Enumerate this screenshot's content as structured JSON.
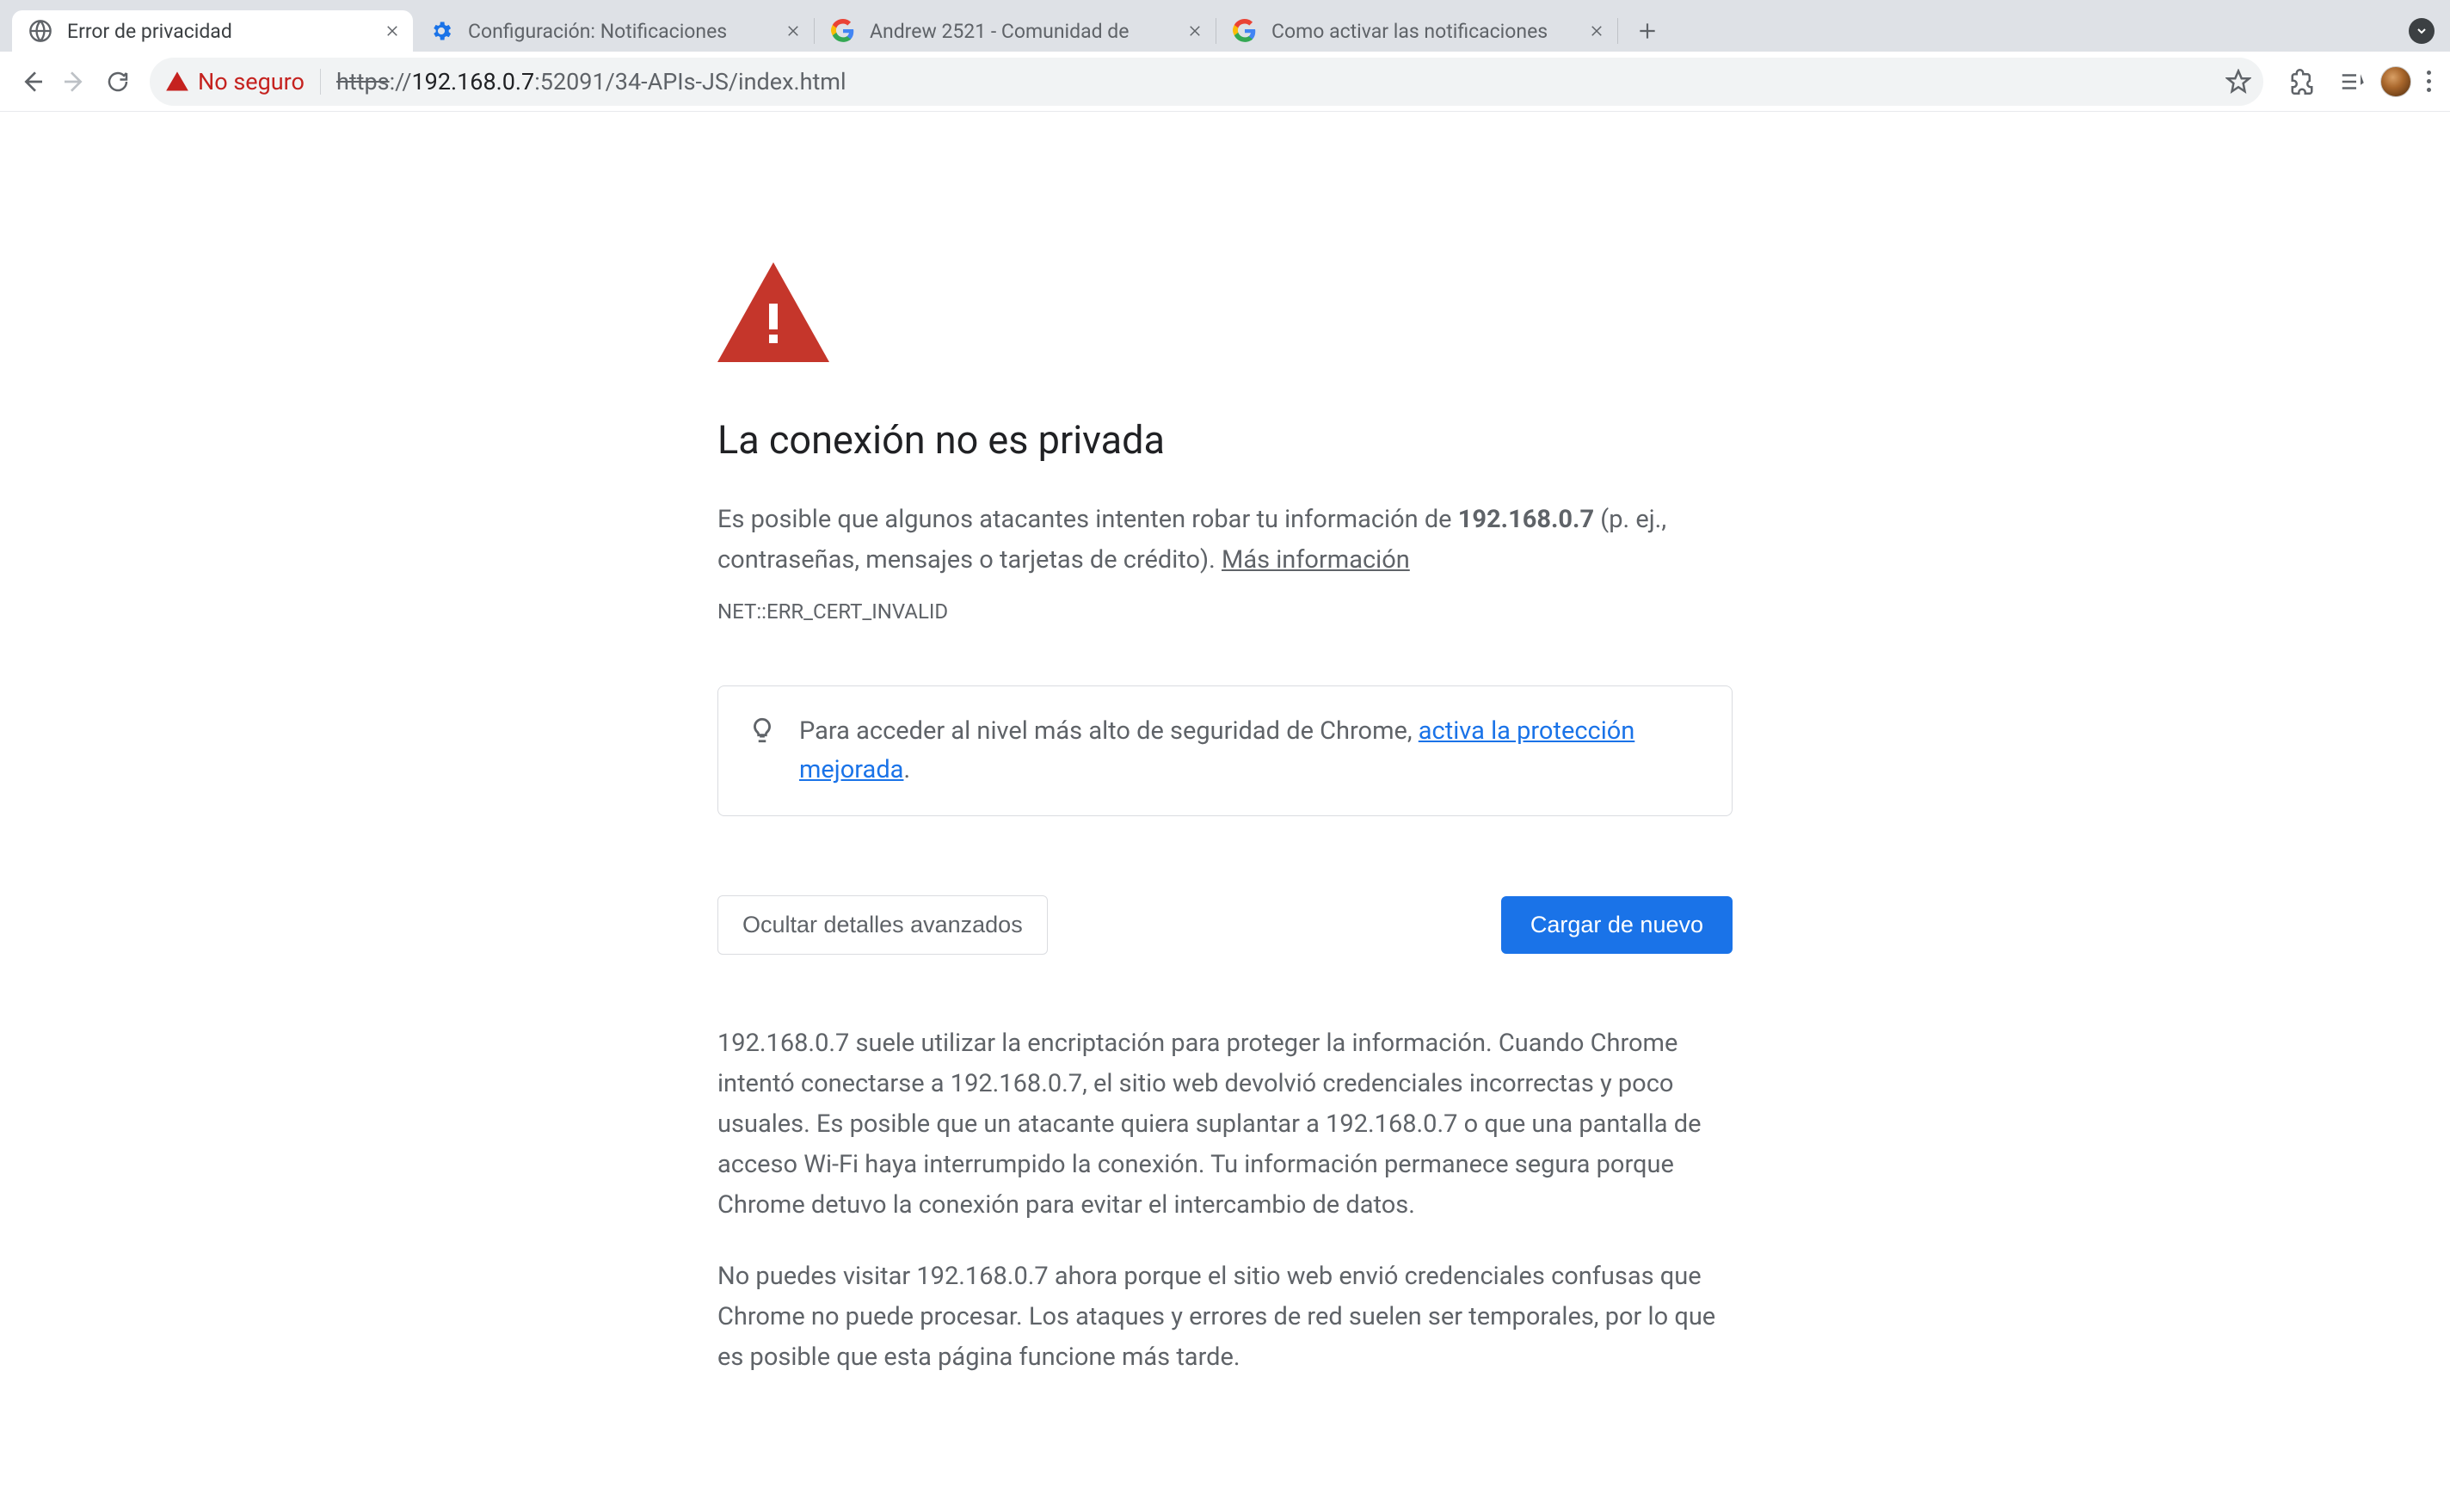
{
  "tabs": [
    {
      "title": "Error de privacidad",
      "icon": "globe"
    },
    {
      "title": "Configuración: Notificaciones",
      "icon": "gear"
    },
    {
      "title": "Andrew 2521 - Comunidad de",
      "icon": "google"
    },
    {
      "title": "Como activar las notificaciones",
      "icon": "google"
    }
  ],
  "omnibox": {
    "security_label": "No seguro",
    "url_scheme": "https",
    "url_sep": "://",
    "url_main": "192.168.0.7",
    "url_rest": ":52091/34-APIs-JS/index.html"
  },
  "page": {
    "heading": "La conexión no es privada",
    "p1a": "Es posible que algunos atacantes intenten robar tu información de ",
    "p1b_bold": "192.168.0.7",
    "p1c": " (p. ej., contraseñas, mensajes o tarjetas de crédito). ",
    "p1_link": "Más información",
    "error_code": "NET::ERR_CERT_INVALID",
    "tip_a": "Para acceder al nivel más alto de seguridad de Chrome, ",
    "tip_link": "activa la protección mejorada",
    "tip_b": ".",
    "btn_hide": "Ocultar detalles avanzados",
    "btn_reload": "Cargar de nuevo",
    "details_p1": "192.168.0.7 suele utilizar la encriptación para proteger la información. Cuando Chrome intentó conectarse a 192.168.0.7, el sitio web devolvió credenciales incorrectas y poco usuales. Es posible que un atacante quiera suplantar a 192.168.0.7 o que una pantalla de acceso Wi-Fi haya interrumpido la conexión. Tu información permanece segura porque Chrome detuvo la conexión para evitar el intercambio de datos.",
    "details_p2": "No puedes visitar 192.168.0.7 ahora porque el sitio web envió credenciales confusas que Chrome no puede procesar. Los ataques y errores de red suelen ser temporales, por lo que es posible que esta página funcione más tarde."
  }
}
